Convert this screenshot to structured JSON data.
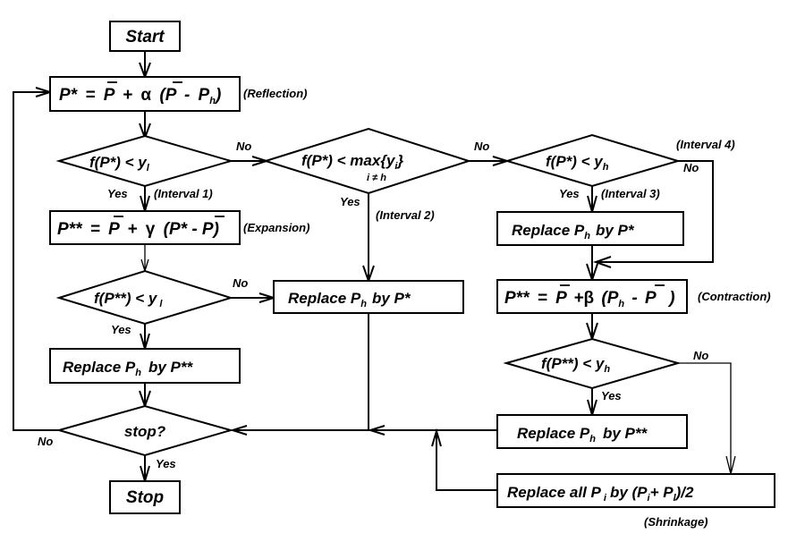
{
  "diagram": {
    "nodes": {
      "start": "Start",
      "reflection": {
        "lhs": "P*",
        "eq": "=",
        "pbar": "P",
        "plus": "+",
        "coef": "α",
        "open": "(",
        "pbar2": "P",
        "minus": "-",
        "ph": "P",
        "ph_sub": "h",
        "close": ")"
      },
      "reflection_note": "(Reflection)",
      "cond1": {
        "text": "f(P*) < y",
        "sub": "l"
      },
      "interval1": "(Interval 1)",
      "cond2": {
        "text": "f(P*) < max{y",
        "close": "}",
        "sub_i": "i",
        "under": "i ≠ h"
      },
      "interval2": "(Interval 2)",
      "cond3": {
        "text": "f(P*) < y",
        "sub": "h"
      },
      "interval3": "(Interval 3)",
      "interval4": "(Interval 4)",
      "expansion": {
        "lhs": "P**",
        "eq": "=",
        "pbar": "P",
        "plus": "+",
        "coef": "γ",
        "body": "(P* - ",
        "pbar2": "P",
        "close": ")"
      },
      "expansion_note": "(Expansion)",
      "cond_exp": {
        "text": "f(P**) < y",
        "sub": "l"
      },
      "replace_ph_pstar_mid": {
        "a": "Replace P",
        "sub": "h",
        "b": "by P*"
      },
      "replace_ph_pstar_right": {
        "a": "Replace P",
        "sub": "h",
        "b": "by P*"
      },
      "replace_ph_pss_left": {
        "a": "Replace P",
        "sub": "h",
        "b": "by P**"
      },
      "contraction": {
        "lhs": "P**",
        "eq": "=",
        "pbar": "P",
        "plus": "+",
        "coef": "β",
        "open": "(P",
        "sub": "h",
        "minus": "-",
        "pbar2": "P",
        "close": ")"
      },
      "contraction_note": "(Contraction)",
      "cond_con": {
        "text": "f(P**) < y",
        "sub": "h"
      },
      "replace_ph_pss_right": {
        "a": "Replace P",
        "sub": "h",
        "b": "by P**"
      },
      "shrink": {
        "a": "Replace all P",
        "sub1": "i",
        "b": "by (P",
        "sub2": "i",
        "c": "+ P",
        "sub3": "l",
        "d": ")/2"
      },
      "shrink_note": "(Shrinkage)",
      "stop_q": "stop?",
      "stop": "Stop"
    },
    "labels": {
      "yes": "Yes",
      "no": "No"
    }
  }
}
